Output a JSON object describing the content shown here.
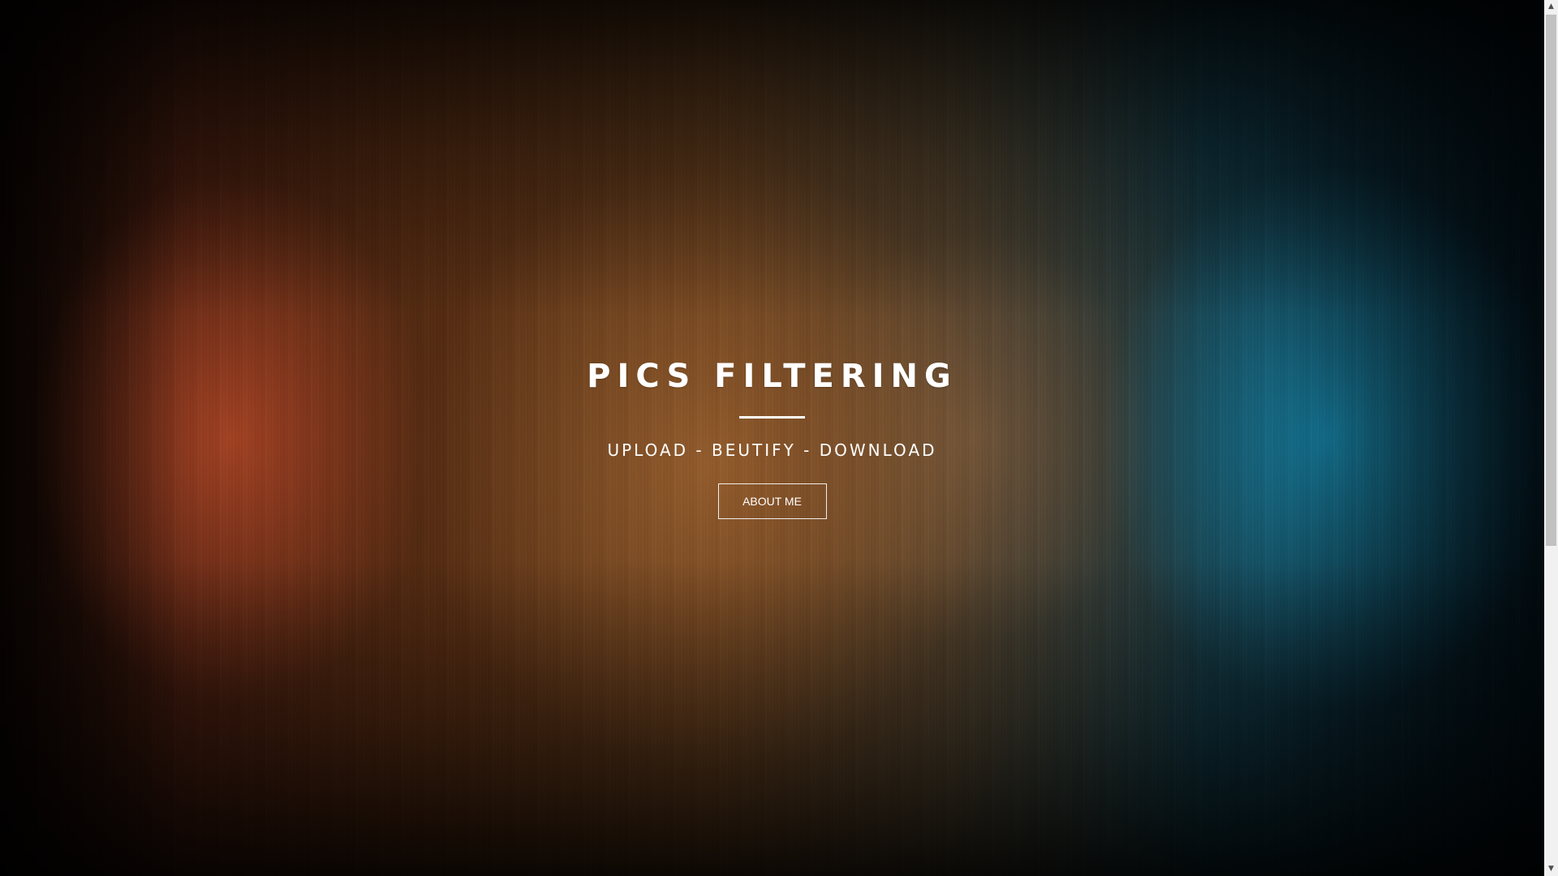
{
  "hero": {
    "title": "PICS FILTERING",
    "tagline": "UPLOAD - BEUTIFY - DOWNLOAD",
    "button_label": "ABOUT ME"
  },
  "scrollbar": {
    "up_icon": "▲",
    "down_icon": "▼"
  },
  "colors": {
    "text": "#ffffff",
    "warm_orange": "#b24928",
    "amber": "#a16632",
    "teal_blue": "#167d9e",
    "scrollbar_track": "#f1f1f1",
    "scrollbar_thumb": "#c1c1c1"
  }
}
